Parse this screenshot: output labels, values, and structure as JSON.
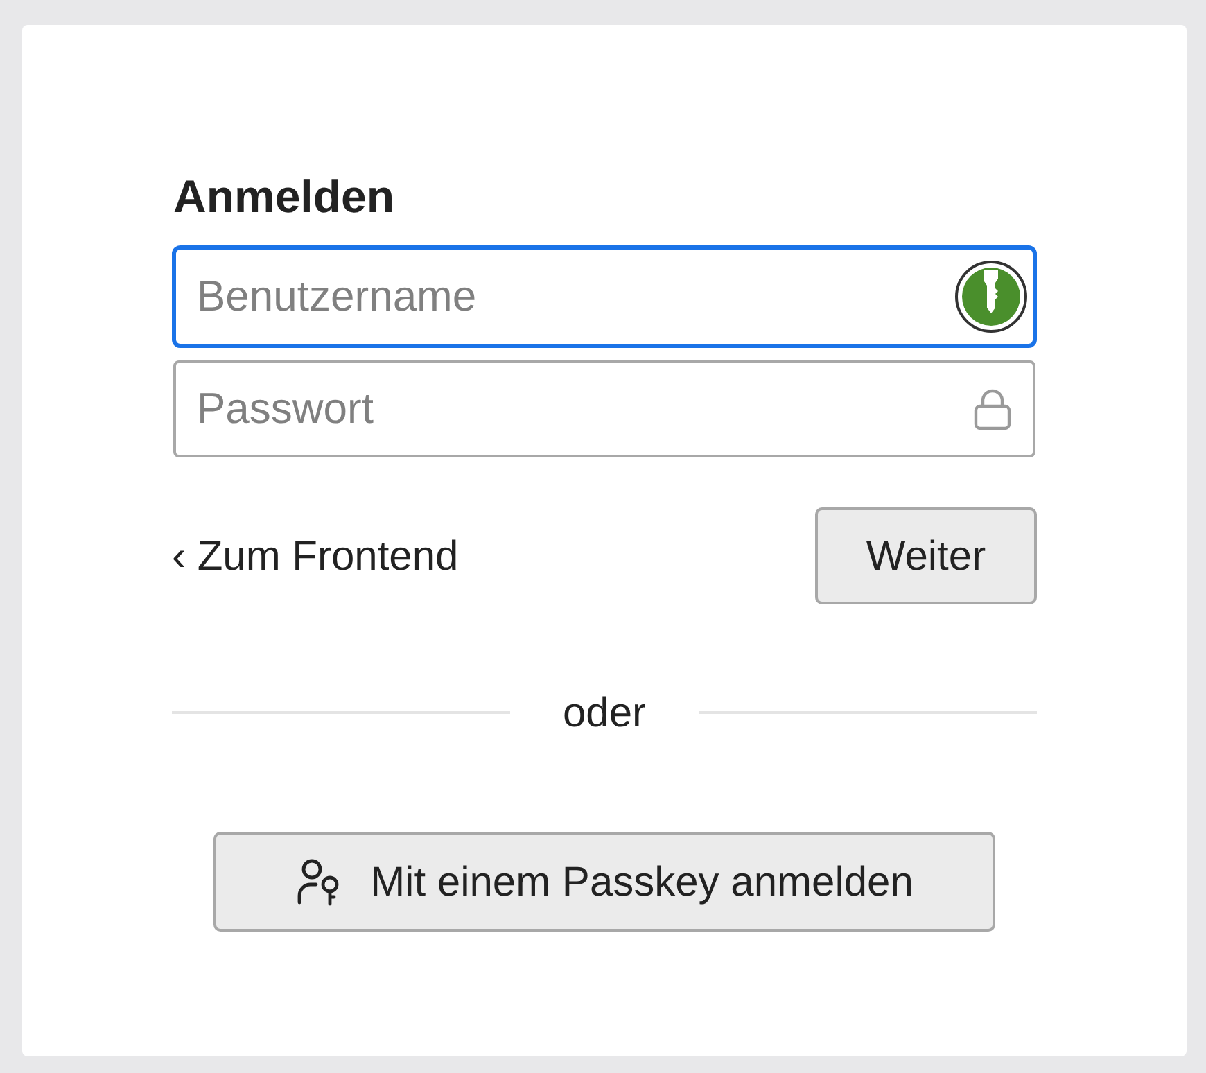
{
  "title": "Anmelden",
  "fields": [
    {
      "kind": "username",
      "placeholder": "Benutzername",
      "focused": true
    },
    {
      "kind": "password",
      "placeholder": "Passwort",
      "focused": false
    }
  ],
  "back_link": "‹ Zum Frontend",
  "submit_button": "Weiter",
  "separator": "oder",
  "passkey_button": "Mit einem Passkey anmelden"
}
